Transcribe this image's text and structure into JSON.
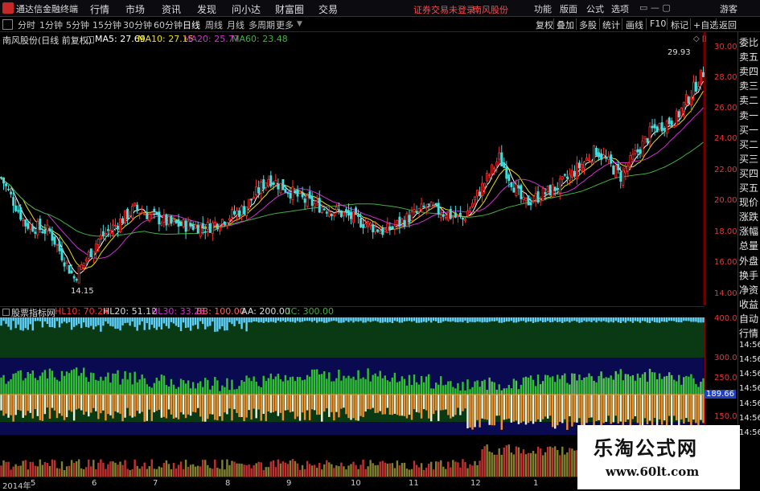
{
  "menubar": {
    "app_title": "通达信金融终端",
    "items": [
      "行情",
      "市场",
      "资讯",
      "发现",
      "问小达",
      "财富圈",
      "交易"
    ],
    "warning": "证券交易未登录",
    "stock_name": "南风股份",
    "right_items": [
      "功能",
      "版面",
      "公式",
      "选项"
    ],
    "guest": "游客"
  },
  "periods": [
    "分时",
    "1分钟",
    "5分钟",
    "15分钟",
    "30分钟",
    "60分钟",
    "日线",
    "周线",
    "月线",
    "多周期",
    "更多"
  ],
  "active_period": "日线",
  "toolbar_right": [
    "复权",
    "叠加",
    "多股",
    "统计",
    "画线",
    "F10",
    "标记",
    "+自选",
    "返回"
  ],
  "chart_header": {
    "stock_label": "南风股份(日线 前复权)",
    "ma5": "MA5: 27.69",
    "ma10": "MA10: 27.15",
    "ma20": "MA20: 25.77",
    "ma60": "MA60: 23.48"
  },
  "price_axis": [
    "30.00",
    "28.00",
    "26.00",
    "24.00",
    "22.00",
    "20.00",
    "18.00",
    "16.00",
    "14.00"
  ],
  "annotations": {
    "high": "29.93",
    "low": "14.15"
  },
  "indicator": {
    "name": "股票指标网",
    "hl10": "HL10: 70.24",
    "hl20": "HL20: 51.12",
    "hl30": "HL30: 33.28",
    "bb": "BB: 100.00",
    "aa": "AA: 200.00",
    "cc": "CC: 300.00",
    "axis": [
      "400.0",
      "300.0",
      "250.0",
      "150.0"
    ],
    "current_value": "189.66"
  },
  "right_panel": [
    "委比",
    "卖五",
    "卖四",
    "卖三",
    "卖二",
    "卖一",
    "买一",
    "买二",
    "买三",
    "买四",
    "买五",
    "现价",
    "涨跌",
    "涨幅",
    "总量",
    "外盘",
    "换手",
    "净资",
    "收益",
    "自动",
    "行情",
    "14:56",
    "14:56",
    "14:56",
    "14:56",
    "14:56",
    "14:56",
    "14:56"
  ],
  "date_axis": [
    "2014年",
    "5",
    "6",
    "7",
    "8",
    "9",
    "10",
    "11",
    "12",
    "1"
  ],
  "watermark": {
    "line1": "乐淘公式网",
    "line2": "www.60lt.com"
  },
  "colors": {
    "ma5": "#ffffff",
    "ma10": "#f0e000",
    "ma20": "#d030d0",
    "ma60": "#40b040",
    "up": "#ff3030",
    "down": "#40e0e0"
  }
}
